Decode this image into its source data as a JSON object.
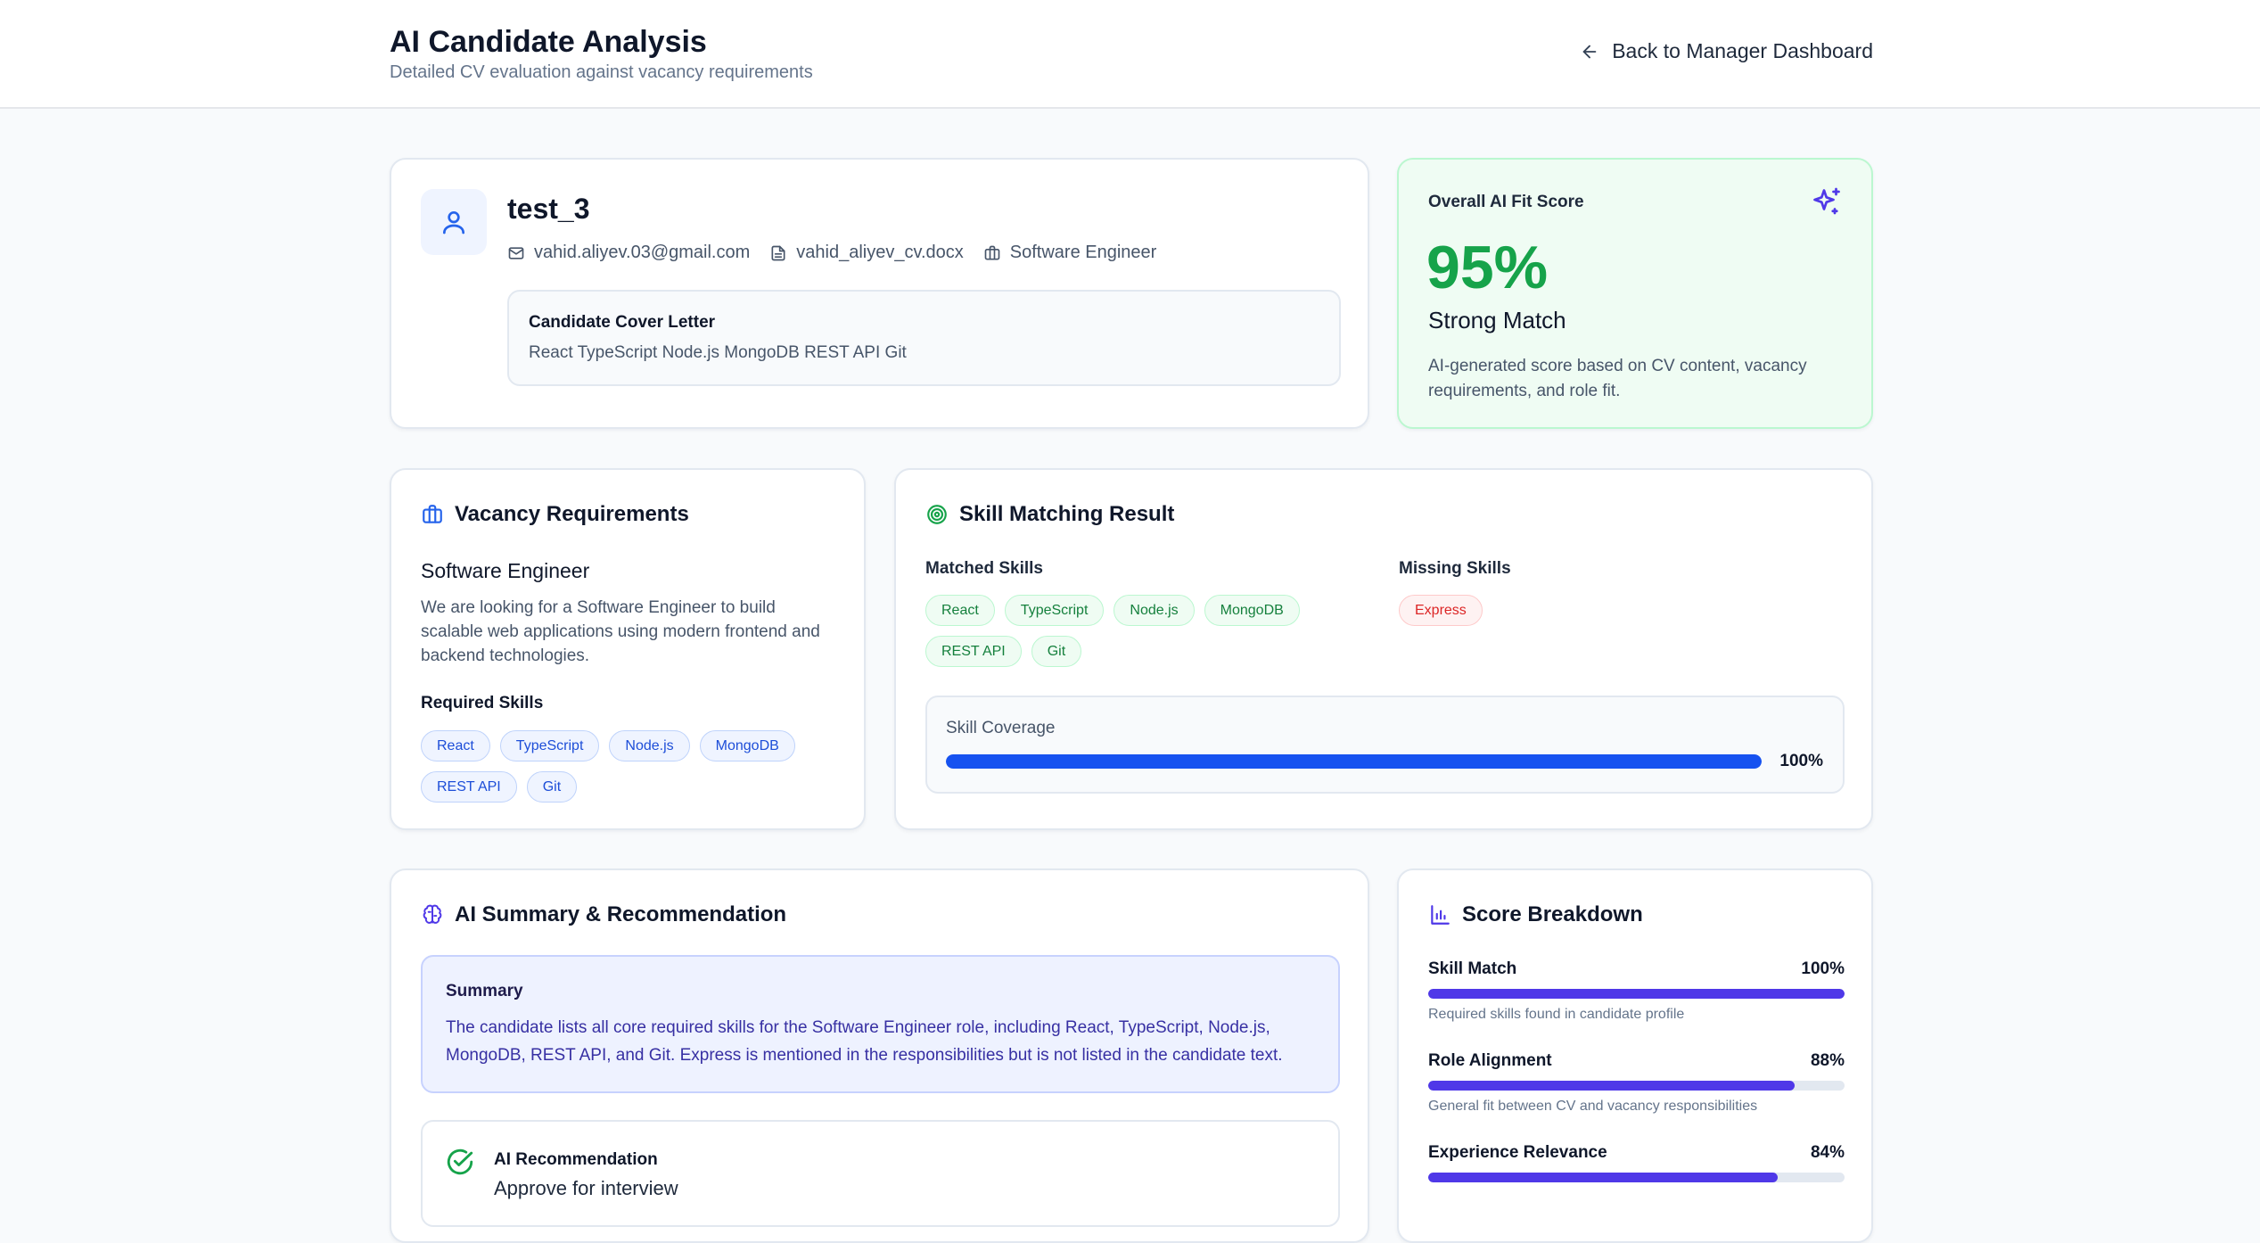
{
  "header": {
    "title": "AI Candidate Analysis",
    "subtitle": "Detailed CV evaluation against vacancy requirements",
    "back_label": "Back to Manager Dashboard"
  },
  "candidate": {
    "name": "test_3",
    "email": "vahid.aliyev.03@gmail.com",
    "cv_file": "vahid_aliyev_cv.docx",
    "role": "Software Engineer",
    "cover_letter_title": "Candidate Cover Letter",
    "cover_letter_text": "React TypeScript Node.js MongoDB REST API Git"
  },
  "score": {
    "label": "Overall AI Fit Score",
    "value": "95%",
    "match": "Strong Match",
    "description": "AI-generated score based on CV content, vacancy requirements, and role fit.",
    "color": "#16a34a"
  },
  "vacancy": {
    "heading": "Vacancy Requirements",
    "role": "Software Engineer",
    "description": "We are looking for a Software Engineer to build scalable web applications using modern frontend and backend technologies.",
    "required_title": "Required Skills",
    "required_skills": [
      "React",
      "TypeScript",
      "Node.js",
      "MongoDB",
      "REST API",
      "Git"
    ]
  },
  "skills": {
    "heading": "Skill Matching Result",
    "matched_title": "Matched Skills",
    "matched": [
      "React",
      "TypeScript",
      "Node.js",
      "MongoDB",
      "REST API",
      "Git"
    ],
    "missing_title": "Missing Skills",
    "missing": [
      "Express"
    ],
    "coverage_label": "Skill Coverage",
    "coverage_value": "100%",
    "coverage_fraction": 1.0
  },
  "summary": {
    "heading": "AI Summary & Recommendation",
    "box_title": "Summary",
    "text": "The candidate lists all core required skills for the Software Engineer role, including React, TypeScript, Node.js, MongoDB, REST API, and Git. Express is mentioned in the responsibilities but is not listed in the candidate text.",
    "recommendation_title": "AI Recommendation",
    "recommendation_value": "Approve for interview"
  },
  "breakdown": {
    "heading": "Score Breakdown",
    "items": [
      {
        "label": "Skill Match",
        "value": "100%",
        "fraction": 1.0,
        "desc": "Required skills found in candidate profile"
      },
      {
        "label": "Role Alignment",
        "value": "88%",
        "fraction": 0.88,
        "desc": "General fit between CV and vacancy responsibilities"
      },
      {
        "label": "Experience Relevance",
        "value": "84%",
        "fraction": 0.84,
        "desc": ""
      }
    ]
  },
  "colors": {
    "accent_blue": "#1652f0",
    "accent_indigo": "#4f38e8",
    "success": "#16a34a",
    "danger": "#dc2626"
  }
}
